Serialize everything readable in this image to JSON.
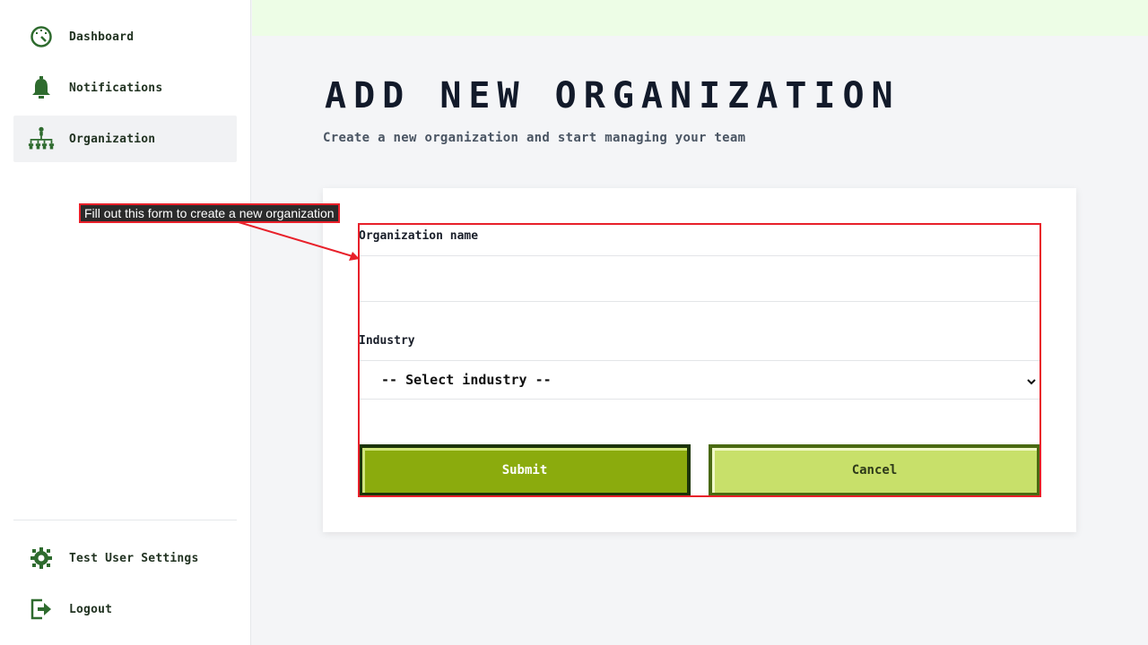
{
  "sidebar": {
    "items": [
      {
        "label": "Dashboard",
        "icon": "dashboard-icon"
      },
      {
        "label": "Notifications",
        "icon": "bell-icon"
      },
      {
        "label": "Organization",
        "icon": "org-chart-icon",
        "active": true
      }
    ],
    "bottom_items": [
      {
        "label": "Test User Settings",
        "icon": "gear-icon"
      },
      {
        "label": "Logout",
        "icon": "logout-icon"
      }
    ]
  },
  "main": {
    "title": "ADD NEW ORGANIZATION",
    "subtitle": "Create a new organization and start managing your team"
  },
  "form": {
    "org_name_label": "Organization name",
    "org_name_value": "",
    "industry_label": "Industry",
    "industry_selected": "-- Select industry --",
    "submit_label": "Submit",
    "cancel_label": "Cancel"
  },
  "annotation": {
    "tooltip_text": "Fill out this form to create a new organization"
  },
  "colors": {
    "icon_green": "#2e6b2e",
    "submit_bg": "#8bab0d",
    "cancel_bg": "#c8e06a",
    "annotation_red": "#e8202a",
    "top_strip": "#edfde6"
  }
}
